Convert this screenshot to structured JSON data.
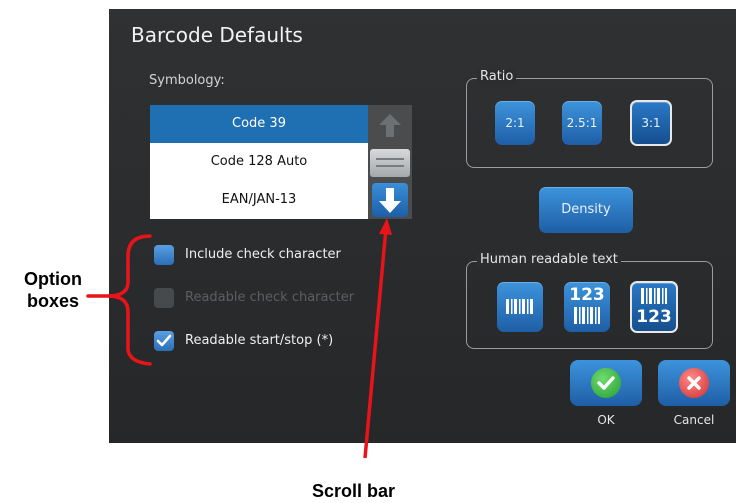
{
  "dialog": {
    "title": "Barcode Defaults",
    "symbology_label": "Symbology:",
    "symbology_items": [
      {
        "label": "Code 39",
        "selected": true
      },
      {
        "label": "Code 128 Auto",
        "selected": false
      },
      {
        "label": "EAN/JAN-13",
        "selected": false
      }
    ],
    "options": [
      {
        "label": "Include check character",
        "checked": false,
        "enabled": true
      },
      {
        "label": "Readable check character",
        "checked": false,
        "enabled": false
      },
      {
        "label": "Readable start/stop (*)",
        "checked": true,
        "enabled": true
      }
    ],
    "ratio": {
      "legend": "Ratio",
      "buttons": [
        {
          "label": "2:1",
          "selected": false
        },
        {
          "label": "2.5:1",
          "selected": false
        },
        {
          "label": "3:1",
          "selected": true
        }
      ]
    },
    "density_label": "Density",
    "human_readable": {
      "legend": "Human readable text",
      "buttons": [
        {
          "icon": "barcode-icon",
          "text": "",
          "selected": false
        },
        {
          "icon": "barcode-text-below-icon",
          "text": "123",
          "selected": false
        },
        {
          "icon": "barcode-text-above-icon",
          "text": "123",
          "selected": true
        }
      ]
    },
    "ok_label": "OK",
    "cancel_label": "Cancel"
  },
  "annotations": {
    "option_boxes": "Option boxes",
    "scroll_bar": "Scroll bar"
  },
  "colors": {
    "accent": "#1f6fb3",
    "annotation": "#e8141a",
    "ok": "#32b043",
    "cancel": "#d83a3a"
  }
}
